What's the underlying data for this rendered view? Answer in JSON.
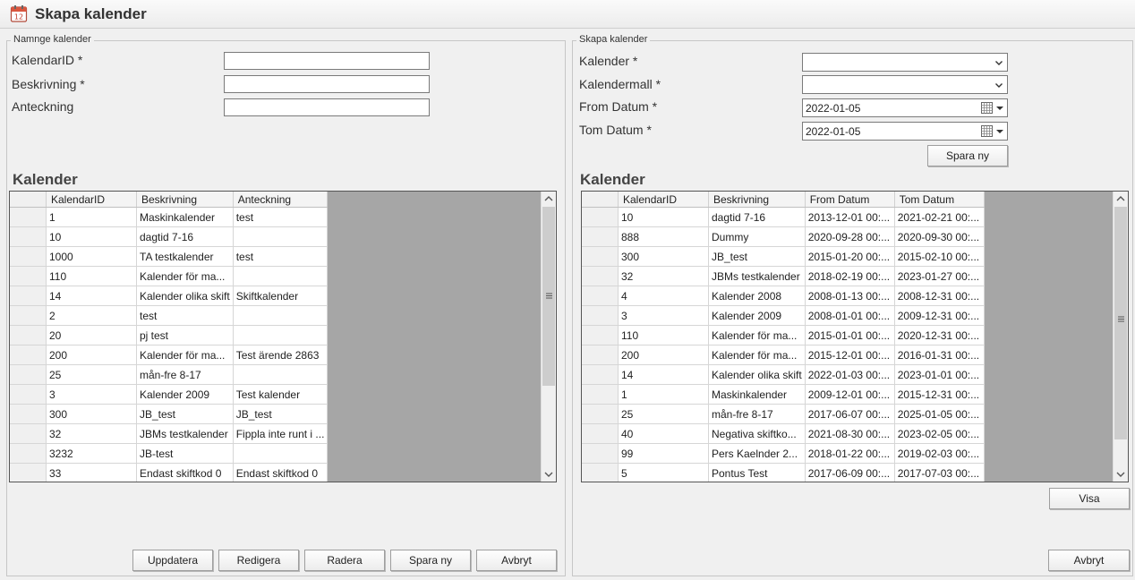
{
  "window": {
    "title": "Skapa kalender",
    "icon": "calendar-icon"
  },
  "left": {
    "group_title": "Namnge kalender",
    "labels": {
      "id": "KalendarID *",
      "desc": "Beskrivning *",
      "note": "Anteckning"
    },
    "values": {
      "id": "",
      "desc": "",
      "note": ""
    },
    "grid_title": "Kalender",
    "columns": [
      "KalendarID",
      "Beskrivning",
      "Anteckning"
    ],
    "rows": [
      [
        "1",
        "Maskinkalender",
        "test"
      ],
      [
        "10",
        "dagtid 7-16",
        ""
      ],
      [
        "1000",
        "TA testkalender",
        "test"
      ],
      [
        "110",
        "Kalender för ma...",
        ""
      ],
      [
        "14",
        "Kalender olika skift",
        "Skiftkalender"
      ],
      [
        "2",
        "test",
        ""
      ],
      [
        "20",
        "pj test",
        ""
      ],
      [
        "200",
        "Kalender för ma...",
        "Test ärende 2863"
      ],
      [
        "25",
        "mån-fre 8-17",
        ""
      ],
      [
        "3",
        "Kalender 2009",
        "Test kalender"
      ],
      [
        "300",
        "JB_test",
        "JB_test"
      ],
      [
        "32",
        "JBMs testkalender",
        "Fippla inte runt i ..."
      ],
      [
        "3232",
        "JB-test",
        ""
      ],
      [
        "33",
        "Endast skiftkod 0",
        "Endast skiftkod 0"
      ]
    ],
    "buttons": [
      "Uppdatera",
      "Redigera",
      "Radera",
      "Spara ny",
      "Avbryt"
    ]
  },
  "right": {
    "group_title": "Skapa kalender",
    "labels": {
      "kalender": "Kalender *",
      "mall": "Kalendermall *",
      "from": "From Datum *",
      "tom": "Tom Datum *"
    },
    "values": {
      "kalender": "",
      "mall": "",
      "from": "2022-01-05",
      "tom": "2022-01-05"
    },
    "save_label": "Spara ny",
    "grid_title": "Kalender",
    "columns": [
      "KalendarID",
      "Beskrivning",
      "From Datum",
      "Tom Datum"
    ],
    "rows": [
      [
        "10",
        "dagtid 7-16",
        "2013-12-01 00:...",
        "2021-02-21 00:..."
      ],
      [
        "888",
        "Dummy",
        "2020-09-28 00:...",
        "2020-09-30 00:..."
      ],
      [
        "300",
        "JB_test",
        "2015-01-20 00:...",
        "2015-02-10 00:..."
      ],
      [
        "32",
        "JBMs testkalender",
        "2018-02-19 00:...",
        "2023-01-27 00:..."
      ],
      [
        "4",
        "Kalender 2008",
        "2008-01-13 00:...",
        "2008-12-31 00:..."
      ],
      [
        "3",
        "Kalender 2009",
        "2008-01-01 00:...",
        "2009-12-31 00:..."
      ],
      [
        "110",
        "Kalender för ma...",
        "2015-01-01 00:...",
        "2020-12-31 00:..."
      ],
      [
        "200",
        "Kalender för ma...",
        "2015-12-01 00:...",
        "2016-01-31 00:..."
      ],
      [
        "14",
        "Kalender olika skift",
        "2022-01-03 00:...",
        "2023-01-01 00:..."
      ],
      [
        "1",
        "Maskinkalender",
        "2009-12-01 00:...",
        "2015-12-31 00:..."
      ],
      [
        "25",
        "mån-fre 8-17",
        "2017-06-07 00:...",
        "2025-01-05 00:..."
      ],
      [
        "40",
        "Negativa skiftko...",
        "2021-08-30 00:...",
        "2023-02-05 00:..."
      ],
      [
        "99",
        "Pers Kaelnder 2...",
        "2018-01-22 00:...",
        "2019-02-03 00:..."
      ],
      [
        "5",
        "Pontus Test",
        "2017-06-09 00:...",
        "2017-07-03 00:..."
      ]
    ],
    "visa_label": "Visa",
    "cancel_label": "Avbryt"
  }
}
